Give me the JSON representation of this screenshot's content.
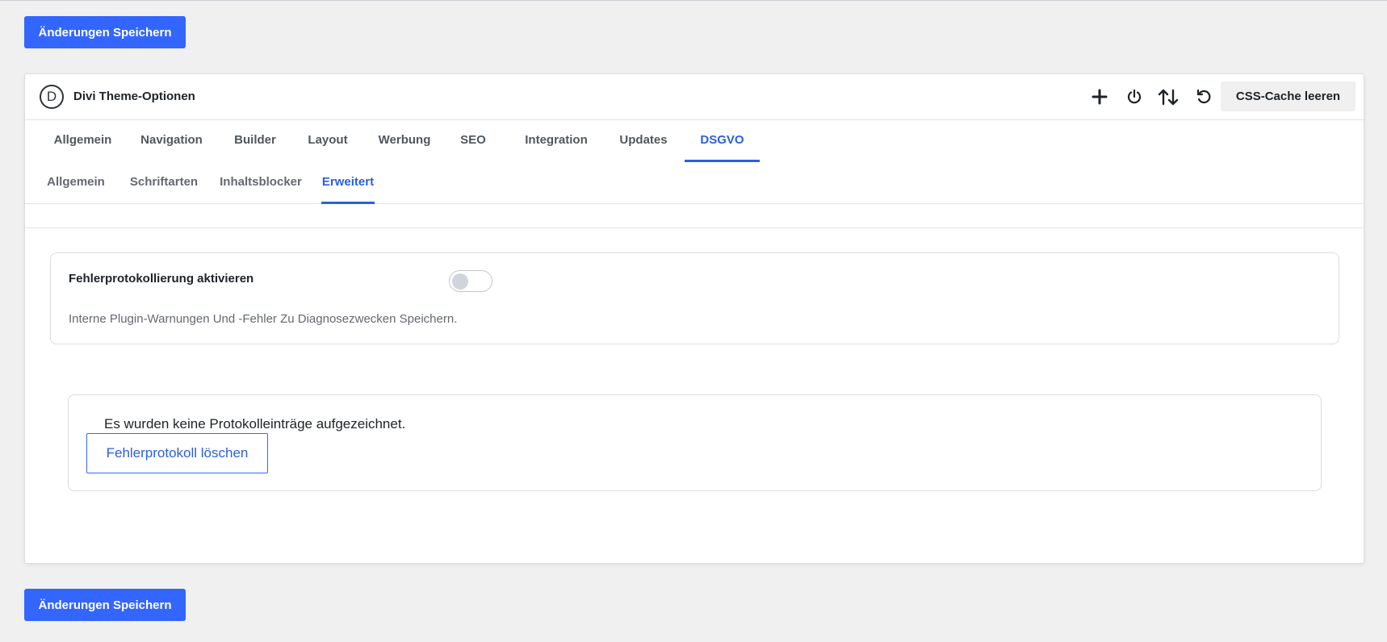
{
  "actions": {
    "save_label": "Änderungen Speichern"
  },
  "panel": {
    "logo_letter": "D",
    "title": "Divi Theme-Optionen",
    "header_icons": [
      "plus-icon",
      "power-icon",
      "sort-arrows-icon",
      "undo-icon"
    ],
    "cache_button_label": "CSS-Cache leeren"
  },
  "tabs": [
    {
      "label": "Allgemein",
      "active": false
    },
    {
      "label": "Navigation",
      "active": false
    },
    {
      "label": "Builder",
      "active": false
    },
    {
      "label": "Layout",
      "active": false
    },
    {
      "label": "Werbung",
      "active": false
    },
    {
      "label": "SEO",
      "active": false
    },
    {
      "label": "Integration",
      "active": false
    },
    {
      "label": "Updates",
      "active": false
    },
    {
      "label": "DSGVO",
      "active": true
    }
  ],
  "subtabs": [
    {
      "label": "Allgemein",
      "active": false
    },
    {
      "label": "Schriftarten",
      "active": false
    },
    {
      "label": "Inhaltsblocker",
      "active": false
    },
    {
      "label": "Erweitert",
      "active": true
    }
  ],
  "setting": {
    "label": "Fehlerprotokollierung aktivieren",
    "enabled": false,
    "description": "Interne Plugin-Warnungen Und -Fehler Zu Diagnosezwecken Speichern."
  },
  "log": {
    "empty_message": "Es wurden keine Protokolleinträge aufgezeichnet.",
    "clear_button_label": "Fehlerprotokoll löschen"
  },
  "colors": {
    "accent": "#3366ff",
    "active_tab": "#2a5fe0",
    "background": "#f0f0f1"
  }
}
